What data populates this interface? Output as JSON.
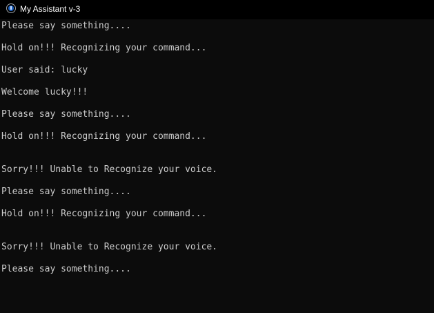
{
  "window": {
    "title": "My Assistant v-3",
    "icon": "assistant-app-icon"
  },
  "console": {
    "lines": [
      "Please say something....",
      "Hold on!!! Recognizing your command...",
      "User said: lucky",
      "Welcome lucky!!!",
      "Please say something....",
      "Hold on!!! Recognizing your command...",
      "Sorry!!! Unable to Recognize your voice.",
      "Please say something....",
      "Hold on!!! Recognizing your command...",
      "Sorry!!! Unable to Recognize your voice.",
      "Please say something...."
    ]
  },
  "colors": {
    "background": "#0c0c0c",
    "titlebar": "#000000",
    "text": "#cccccc"
  }
}
